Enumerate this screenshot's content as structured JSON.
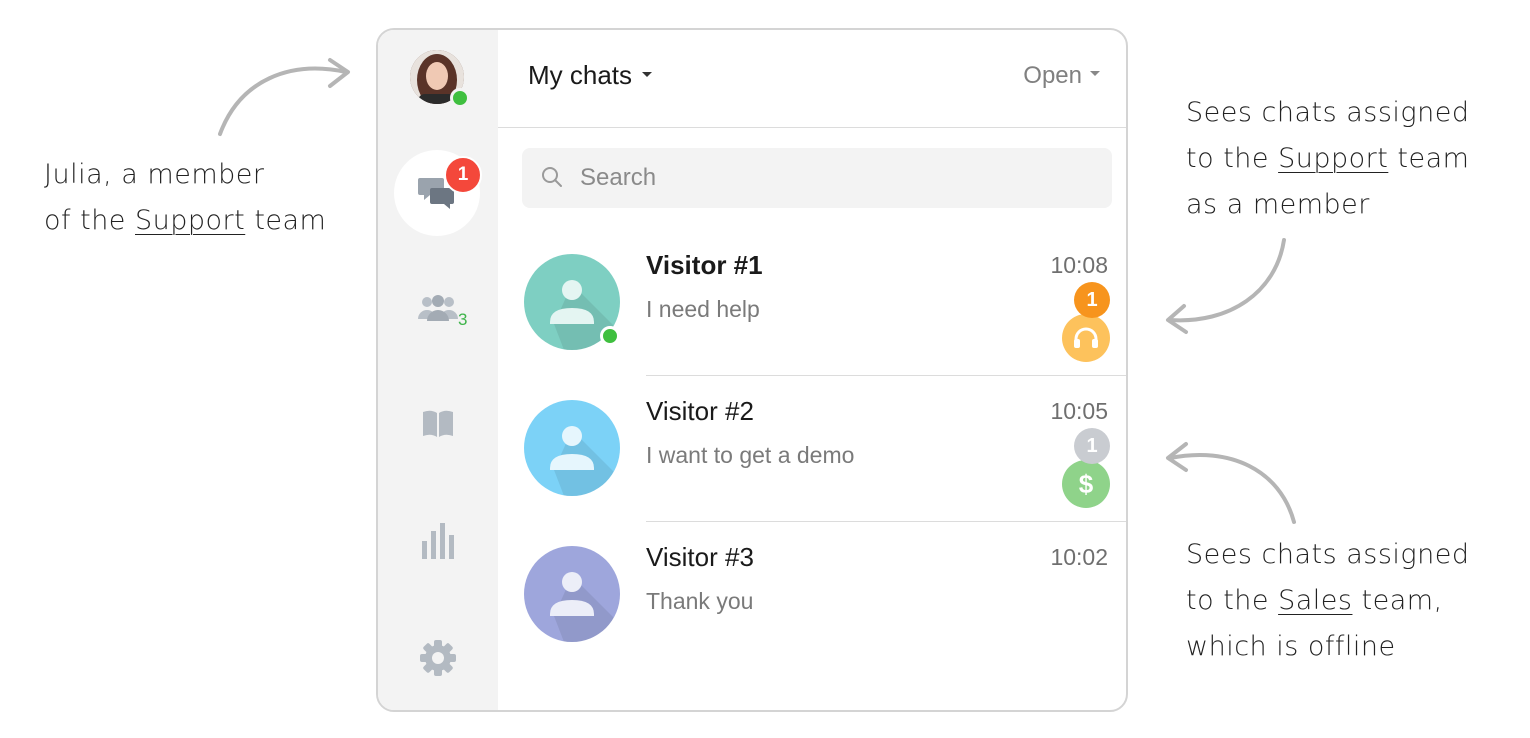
{
  "annotations": {
    "julia": {
      "line1": "Julia, a member",
      "line2_pre": "of the ",
      "line2_team": "Support",
      "line2_post": " team"
    },
    "support": {
      "line1": "Sees chats assigned",
      "line2_pre": "to the ",
      "line2_team": "Support",
      "line2_post": " team",
      "line3": "as a member"
    },
    "sales": {
      "line1": "Sees chats assigned",
      "line2_pre": "to the ",
      "line2_team": "Sales",
      "line2_post": " team,",
      "line3": "which is offline"
    }
  },
  "sidebar": {
    "chats_badge": "1",
    "teams_count": "3",
    "icons": [
      "chat-bubbles-icon",
      "team-icon",
      "book-icon",
      "bar-chart-icon",
      "gear-icon"
    ]
  },
  "header": {
    "title": "My chats",
    "filter": "Open"
  },
  "search": {
    "placeholder": "Search"
  },
  "chats": [
    {
      "name": "Visitor #1",
      "message": "I need help",
      "time": "10:08",
      "unread": "1",
      "team_icon": "headset-icon",
      "online": true,
      "avatar_color": "#7ecfc2",
      "team_color": "#fdc25c",
      "unread_color": "#f7941d"
    },
    {
      "name": "Visitor #2",
      "message": "I want to get a demo",
      "time": "10:05",
      "unread": "1",
      "team_icon": "dollar-icon",
      "team_glyph": "$",
      "online": false,
      "avatar_color": "#7cd2f7",
      "team_color": "#8fd38a",
      "unread_color": "#c9ccd1"
    },
    {
      "name": "Visitor #3",
      "message": "Thank you",
      "time": "10:02",
      "online": false,
      "avatar_color": "#9ea6dc"
    }
  ],
  "colors": {
    "accent_red": "#f4483b",
    "online_green": "#3fbf3f",
    "rail_bg": "#f3f3f3"
  }
}
